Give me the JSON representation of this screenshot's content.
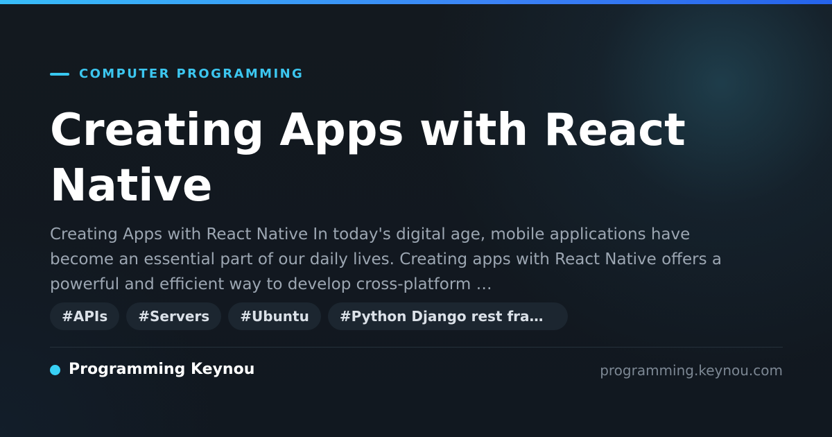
{
  "category": "COMPUTER PROGRAMMING",
  "title": "Creating Apps with React Native",
  "description": "Creating Apps with React Native In today's digital age, mobile applications have become an essential part of our daily lives. Creating apps with React Native offers a powerful and efficient way to develop cross-platform …",
  "tags": [
    "#APIs",
    "#Servers",
    "#Ubuntu",
    "#Python Django rest fram…"
  ],
  "footer": {
    "site_name": "Programming Keynou",
    "site_url": "programming.keynou.com"
  },
  "colors": {
    "background": "#111820",
    "accent": "#38c8f0",
    "top_bar_start": "#38bdf8",
    "top_bar_end": "#2563eb",
    "title": "#ffffff",
    "description": "#9ca6b2",
    "tag_background": "#1c2630",
    "tag_text": "#dbe1e8",
    "url": "#7c8793"
  }
}
